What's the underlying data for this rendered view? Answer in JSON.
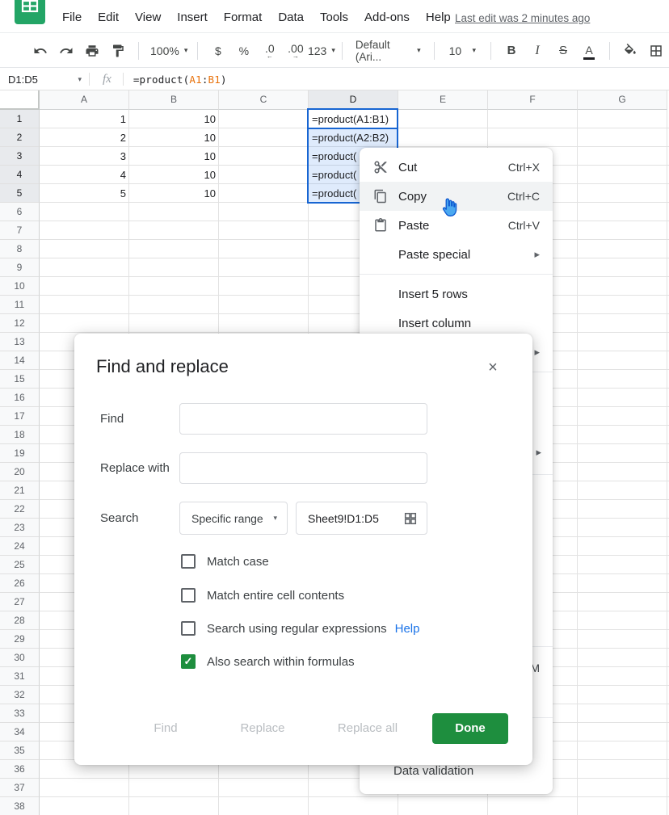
{
  "app": {
    "menu_items": [
      "File",
      "Edit",
      "View",
      "Insert",
      "Format",
      "Data",
      "Tools",
      "Add-ons",
      "Help"
    ],
    "last_edit": "Last edit was 2 minutes ago"
  },
  "toolbar": {
    "zoom": "100%",
    "currency": "$",
    "percent": "%",
    "decrease_decimal": ".0",
    "increase_decimal": ".00",
    "more_formats": "123",
    "font_name": "Default (Ari...",
    "font_size": "10",
    "bold": "B",
    "italic": "I",
    "strikethrough": "S",
    "text_color": "A"
  },
  "formula_bar": {
    "name_box": "D1:D5",
    "fx_label": "fx",
    "formula": {
      "pre": "=product(",
      "ref_start": "A1",
      "colon": ":",
      "ref_end": "B1",
      "close": ")"
    }
  },
  "grid": {
    "columns": [
      "A",
      "B",
      "C",
      "D",
      "E",
      "F",
      "G"
    ],
    "row_count": 38,
    "selected_column": "D",
    "selected_rows_from": 1,
    "selected_rows_to": 5,
    "cells": [
      {
        "col": "A",
        "row": 1,
        "text": "1",
        "align": "right"
      },
      {
        "col": "A",
        "row": 2,
        "text": "2",
        "align": "right"
      },
      {
        "col": "A",
        "row": 3,
        "text": "3",
        "align": "right"
      },
      {
        "col": "A",
        "row": 4,
        "text": "4",
        "align": "right"
      },
      {
        "col": "A",
        "row": 5,
        "text": "5",
        "align": "right"
      },
      {
        "col": "B",
        "row": 1,
        "text": "10",
        "align": "right"
      },
      {
        "col": "B",
        "row": 2,
        "text": "10",
        "align": "right"
      },
      {
        "col": "B",
        "row": 3,
        "text": "10",
        "align": "right"
      },
      {
        "col": "B",
        "row": 4,
        "text": "10",
        "align": "right"
      },
      {
        "col": "B",
        "row": 5,
        "text": "10",
        "align": "right"
      },
      {
        "col": "D",
        "row": 1,
        "text": "=product(A1:B1)",
        "align": "left"
      },
      {
        "col": "D",
        "row": 2,
        "text": "=product(A2:B2)",
        "align": "left"
      },
      {
        "col": "D",
        "row": 3,
        "text": "=product(",
        "align": "left"
      },
      {
        "col": "D",
        "row": 4,
        "text": "=product(",
        "align": "left"
      },
      {
        "col": "D",
        "row": 5,
        "text": "=product(",
        "align": "left"
      }
    ]
  },
  "context_menu": {
    "items": [
      {
        "type": "item",
        "icon": "scissors-icon",
        "label": "Cut",
        "shortcut": "Ctrl+X"
      },
      {
        "type": "item",
        "icon": "copy-icon",
        "label": "Copy",
        "shortcut": "Ctrl+C",
        "highlighted": true
      },
      {
        "type": "item",
        "icon": "paste-icon",
        "label": "Paste",
        "shortcut": "Ctrl+V"
      },
      {
        "type": "item",
        "label": "Paste special",
        "submenu": true
      },
      {
        "type": "divider"
      },
      {
        "type": "item",
        "label": "Insert 5 rows"
      },
      {
        "type": "item",
        "label": "Insert column"
      },
      {
        "type": "item",
        "label": "",
        "submenu": true
      },
      {
        "type": "divider"
      }
    ],
    "partial": {
      "shortcut_fragment": "M",
      "bottom_item": "Data validation"
    }
  },
  "dialog": {
    "title": "Find and replace",
    "find_label": "Find",
    "find_value": "",
    "replace_label": "Replace with",
    "replace_value": "",
    "search_label": "Search",
    "search_value": "Specific range",
    "range_value": "Sheet9!D1:D5",
    "checkboxes": [
      {
        "label": "Match case",
        "checked": false
      },
      {
        "label": "Match entire cell contents",
        "checked": false
      },
      {
        "label": "Search using regular expressions",
        "checked": false,
        "link": "Help"
      },
      {
        "label": "Also search within formulas",
        "checked": true
      }
    ],
    "buttons": {
      "find": "Find",
      "replace": "Replace",
      "replace_all": "Replace all",
      "done": "Done"
    }
  },
  "icons": {
    "dropdown": "▾",
    "submenu": "▸",
    "close": "×",
    "check": "✓"
  },
  "colors": {
    "accent_green": "#1e8e3e",
    "selection_blue": "#1765d2",
    "link_blue": "#1a73e8",
    "reference_orange": "#e8710a",
    "logo_green": "#23a566"
  }
}
